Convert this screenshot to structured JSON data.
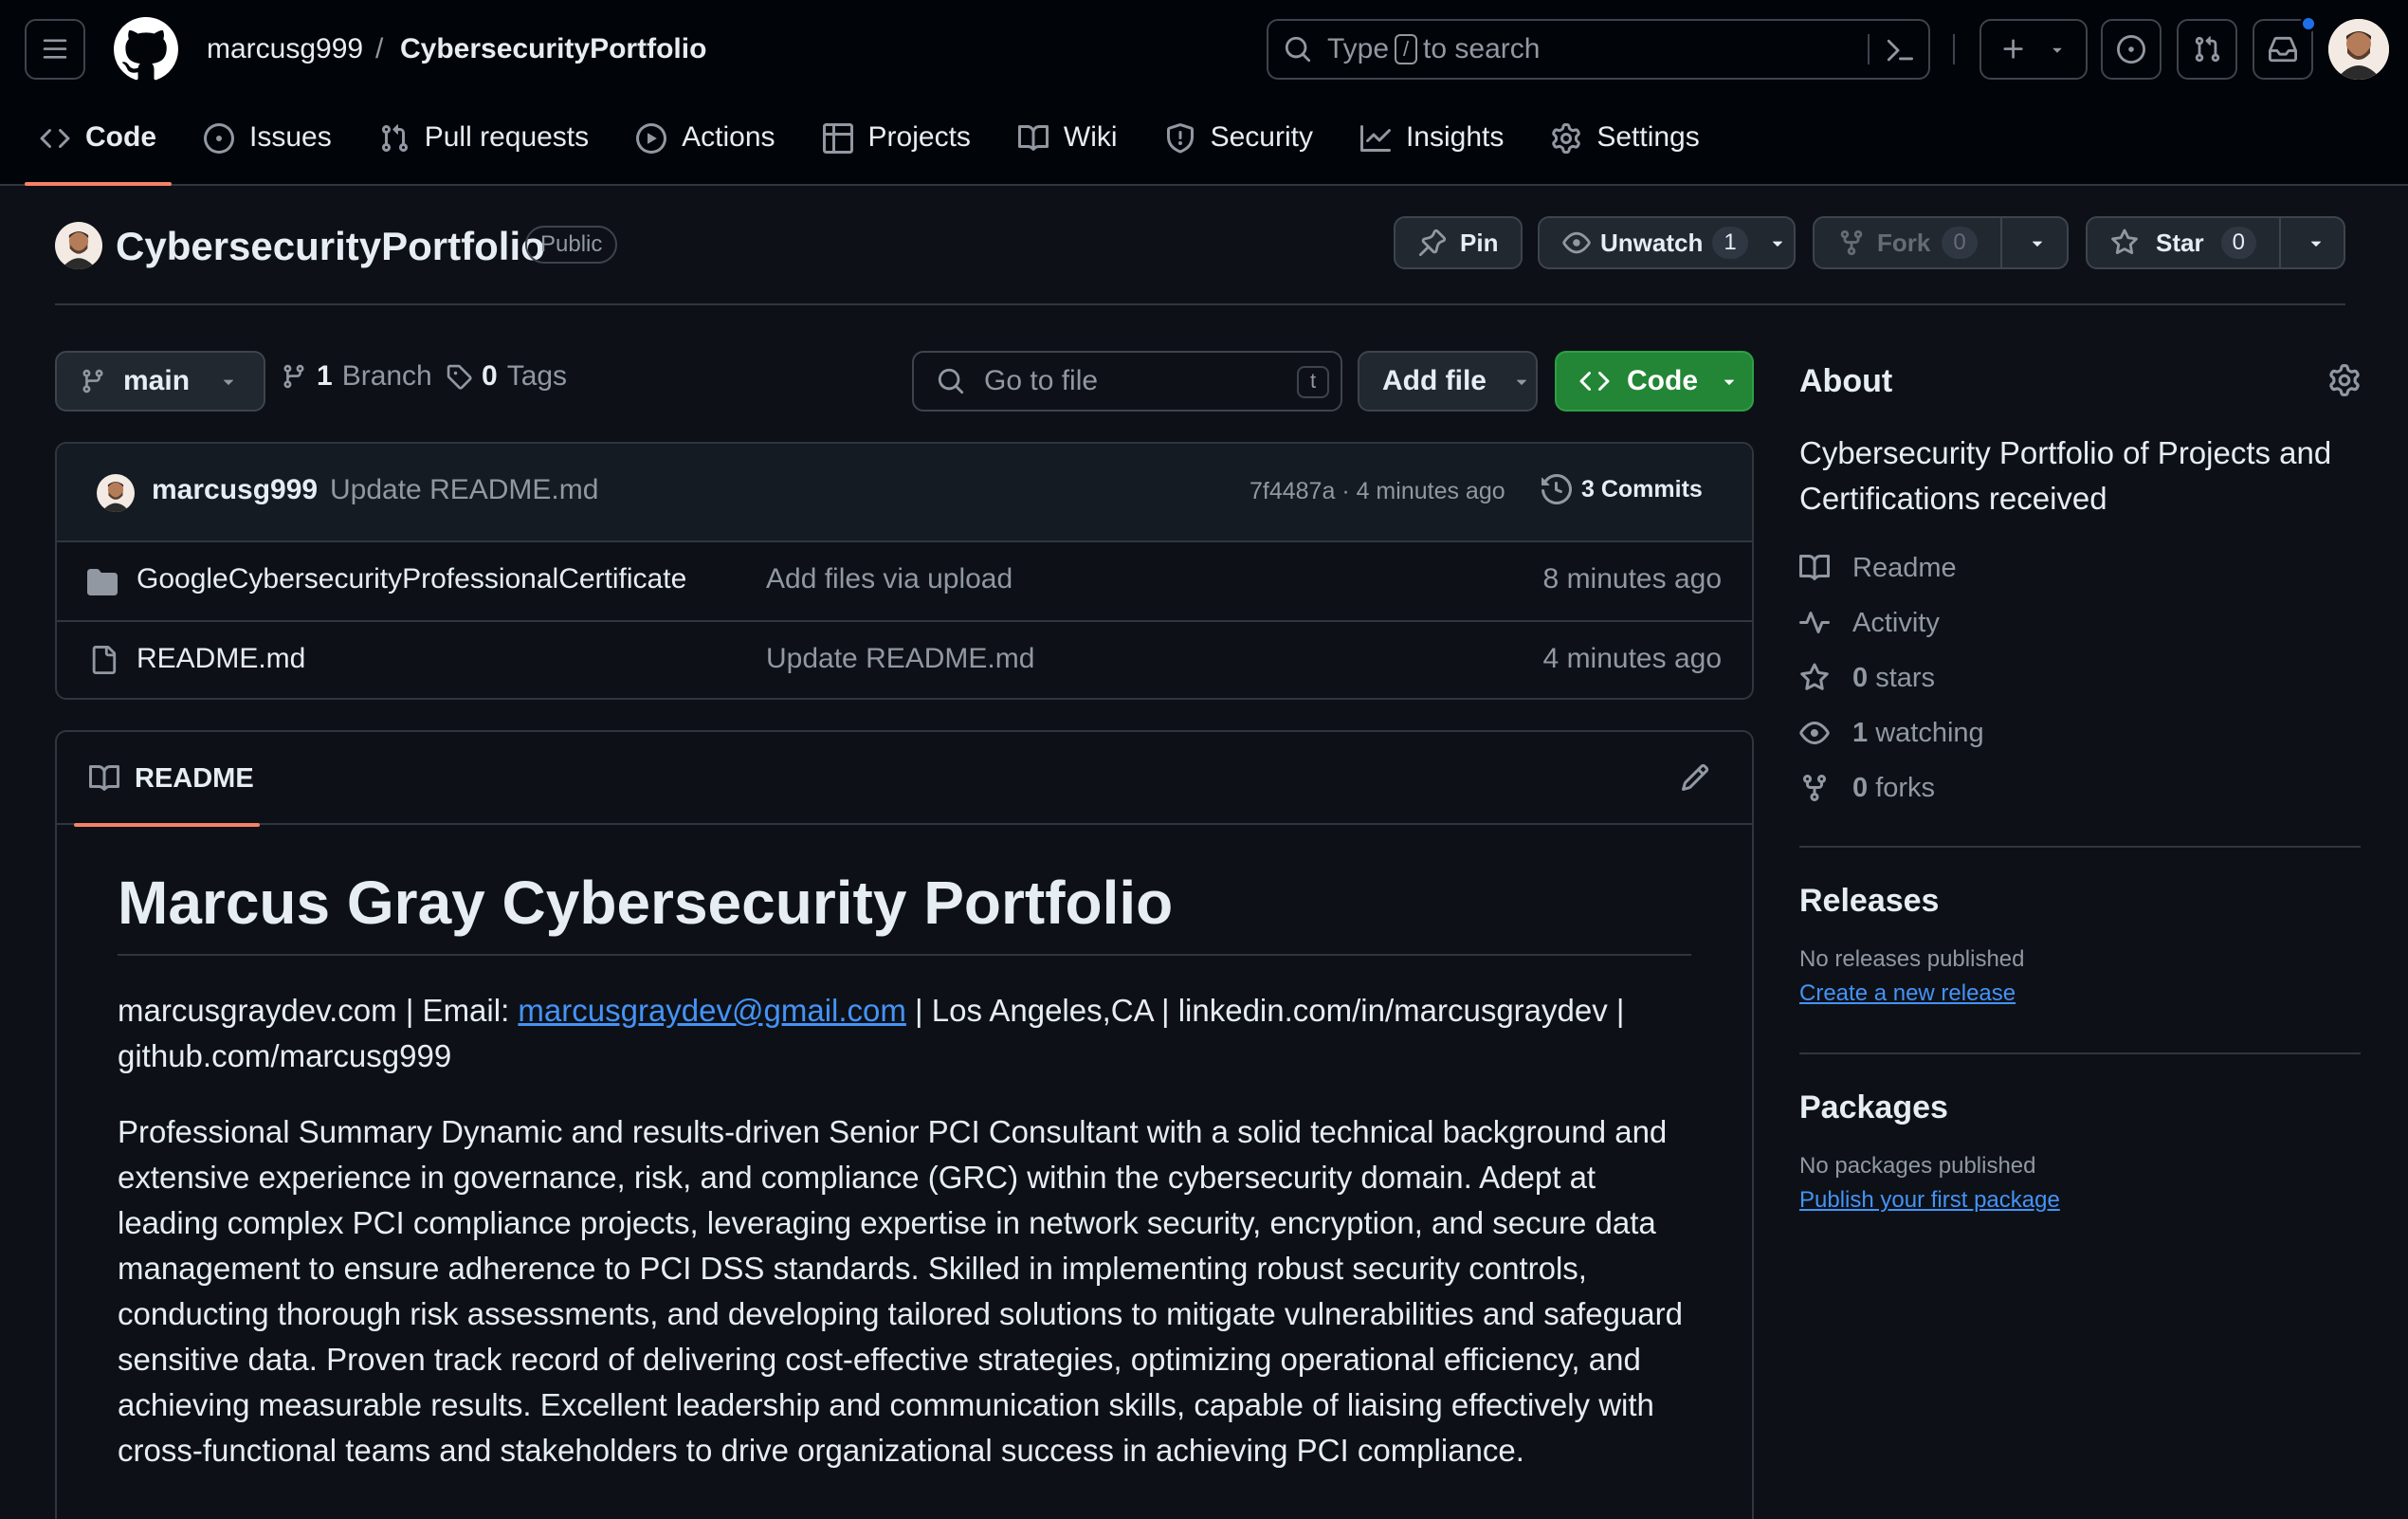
{
  "header": {
    "owner": "marcusg999",
    "separator": "/",
    "repo": "CybersecurityPortfolio",
    "search_prefix": "Type",
    "search_key": "/",
    "search_suffix": "to search"
  },
  "tabs": [
    {
      "label": "Code",
      "icon": "code-icon",
      "active": true
    },
    {
      "label": "Issues",
      "icon": "issue-icon"
    },
    {
      "label": "Pull requests",
      "icon": "pull-request-icon"
    },
    {
      "label": "Actions",
      "icon": "play-icon"
    },
    {
      "label": "Projects",
      "icon": "table-icon"
    },
    {
      "label": "Wiki",
      "icon": "book-icon"
    },
    {
      "label": "Security",
      "icon": "shield-icon"
    },
    {
      "label": "Insights",
      "icon": "graph-icon"
    },
    {
      "label": "Settings",
      "icon": "gear-icon"
    }
  ],
  "repo_header": {
    "title": "CybersecurityPortfolio",
    "visibility": "Public",
    "pin": "Pin",
    "watch": "Unwatch",
    "watch_count": "1",
    "fork": "Fork",
    "fork_count": "0",
    "star": "Star",
    "star_count": "0"
  },
  "branch_bar": {
    "branch": "main",
    "branch_count": "1",
    "branch_label": "Branch",
    "tag_count": "0",
    "tag_label": "Tags",
    "goto_placeholder": "Go to file",
    "goto_key": "t",
    "add_file": "Add file",
    "code": "Code"
  },
  "commit": {
    "author": "marcusg999",
    "message": "Update README.md",
    "hash_time": "7f4487a · 4 minutes ago",
    "commits": "3 Commits"
  },
  "files": [
    {
      "name": "GoogleCybersecurityProfessionalCertificate",
      "type": "folder",
      "message": "Add files via upload",
      "time": "8 minutes ago"
    },
    {
      "name": "README.md",
      "type": "file",
      "message": "Update README.md",
      "time": "4 minutes ago"
    }
  ],
  "readme": {
    "tab": "README",
    "heading": "Marcus Gray Cybersecurity Portfolio",
    "contact_pre": "marcusgraydev.com | Email: ",
    "contact_email": "marcusgraydev@gmail.com",
    "contact_post": " | Los Angeles,CA | linkedin.com/in/marcusgraydev | github.com/marcusg999",
    "summary": "Professional Summary Dynamic and results-driven Senior PCI Consultant with a solid technical background and extensive experience in governance, risk, and compliance (GRC) within the cybersecurity domain. Adept at leading complex PCI compliance projects, leveraging expertise in network security, encryption, and secure data management to ensure adherence to PCI DSS standards. Skilled in implementing robust security controls, conducting thorough risk assessments, and developing tailored solutions to mitigate vulnerabilities and safeguard sensitive data. Proven track record of delivering cost-effective strategies, optimizing operational efficiency, and achieving measurable results. Excellent leadership and communication skills, capable of liaising effectively with cross-functional teams and stakeholders to drive organizational success in achieving PCI compliance."
  },
  "sidebar": {
    "about_title": "About",
    "description": "Cybersecurity Portfolio of Projects and Certifications received",
    "readme": "Readme",
    "activity": "Activity",
    "stars_count": "0",
    "stars_label": "stars",
    "watching_count": "1",
    "watching_label": "watching",
    "forks_count": "0",
    "forks_label": "forks",
    "releases_title": "Releases",
    "releases_empty": "No releases published",
    "releases_link": "Create a new release",
    "packages_title": "Packages",
    "packages_empty": "No packages published",
    "packages_link": "Publish your first package"
  },
  "colors": {
    "background": "#0d1117",
    "header": "#010409",
    "accent_tab": "#f78166",
    "primary_button": "#238636",
    "link": "#4493f8",
    "notification_dot": "#1f6feb"
  }
}
